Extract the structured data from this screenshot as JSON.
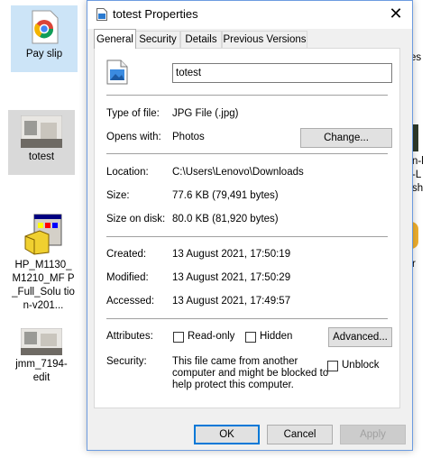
{
  "desktop": {
    "icons": [
      {
        "label": "Pay slip"
      },
      {
        "label": "totest"
      },
      {
        "label": "HP_M1130_ M1210_MF P_Full_Solu tion-v201..."
      },
      {
        "label": "jmm_7194- edit"
      }
    ],
    "partial_right": [
      "es",
      "n-l",
      "-L",
      "sh",
      "r"
    ]
  },
  "window": {
    "title": "totest Properties",
    "close_glyph": "✕",
    "tabs": [
      {
        "label": "General",
        "active": true
      },
      {
        "label": "Security",
        "active": false
      },
      {
        "label": "Details",
        "active": false
      },
      {
        "label": "Previous Versions",
        "active": false
      }
    ],
    "file_name": "totest",
    "type_of_file": {
      "label": "Type of file:",
      "value": "JPG File (.jpg)"
    },
    "opens_with": {
      "label": "Opens with:",
      "value": "Photos",
      "button": "Change..."
    },
    "location": {
      "label": "Location:",
      "value": "C:\\Users\\Lenovo\\Downloads"
    },
    "size": {
      "label": "Size:",
      "value": "77.6 KB (79,491 bytes)"
    },
    "size_on_disk": {
      "label": "Size on disk:",
      "value": "80.0 KB (81,920 bytes)"
    },
    "created": {
      "label": "Created:",
      "value": "13 August 2021, 17:50:19"
    },
    "modified": {
      "label": "Modified:",
      "value": "13 August 2021, 17:50:29"
    },
    "accessed": {
      "label": "Accessed:",
      "value": "13 August 2021, 17:49:57"
    },
    "attributes": {
      "label": "Attributes:",
      "read_only": "Read-only",
      "hidden": "Hidden",
      "advanced_button": "Advanced..."
    },
    "security": {
      "label": "Security:",
      "line1": "This file came from another",
      "line2": "computer and might be blocked to",
      "line3": "help protect this computer.",
      "unblock": "Unblock"
    },
    "buttons": {
      "ok": "OK",
      "cancel": "Cancel",
      "apply": "Apply"
    },
    "accent_color": "#0078d7"
  }
}
